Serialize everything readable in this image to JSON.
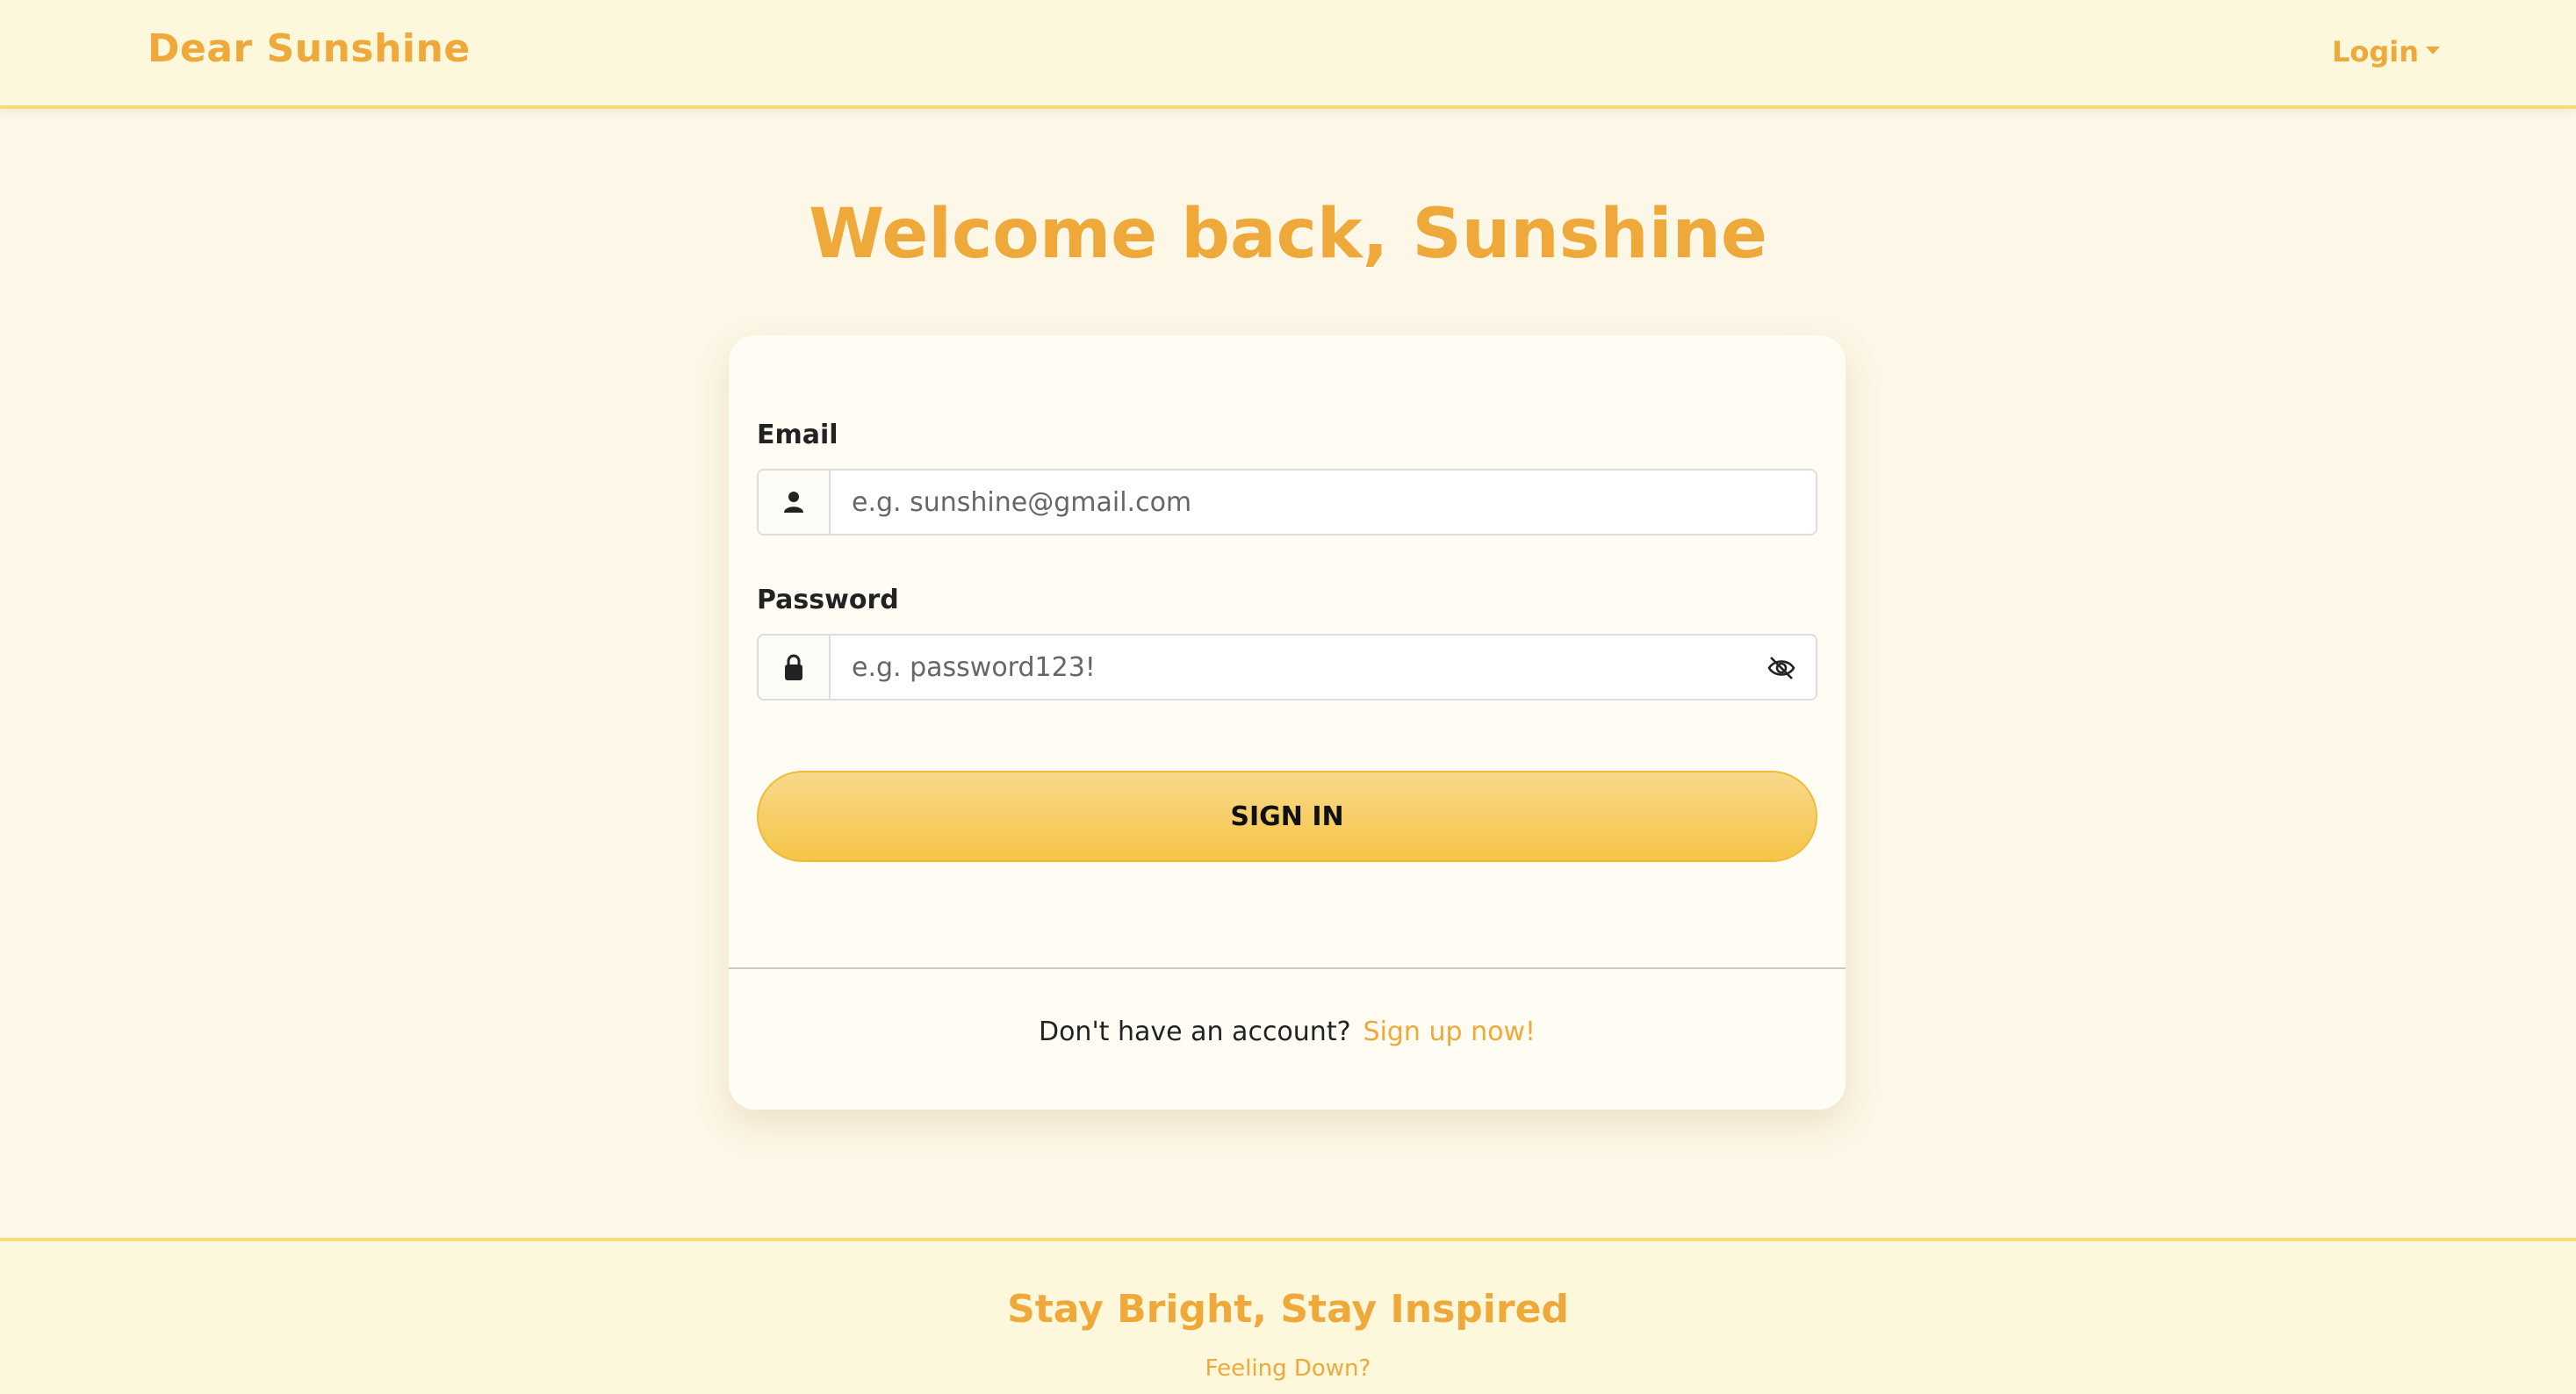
{
  "navbar": {
    "brand": "Dear Sunshine",
    "login_label": "Login"
  },
  "main": {
    "heading": "Welcome back, Sunshine"
  },
  "form": {
    "email": {
      "label": "Email",
      "placeholder": "e.g. sunshine@gmail.com",
      "icon": "user-icon"
    },
    "password": {
      "label": "Password",
      "placeholder": "e.g. password123!",
      "icon": "lock-icon",
      "toggle_icon": "eye-slash-icon"
    },
    "submit_label": "SIGN IN"
  },
  "signup": {
    "prompt": "Don't have an account?",
    "link": "Sign up now!"
  },
  "footer": {
    "title": "Stay Bright, Stay Inspired",
    "link": "Feeling Down?"
  },
  "colors": {
    "accent": "#eea93a",
    "button": "#f6c548",
    "background": "#fdf7e7"
  }
}
